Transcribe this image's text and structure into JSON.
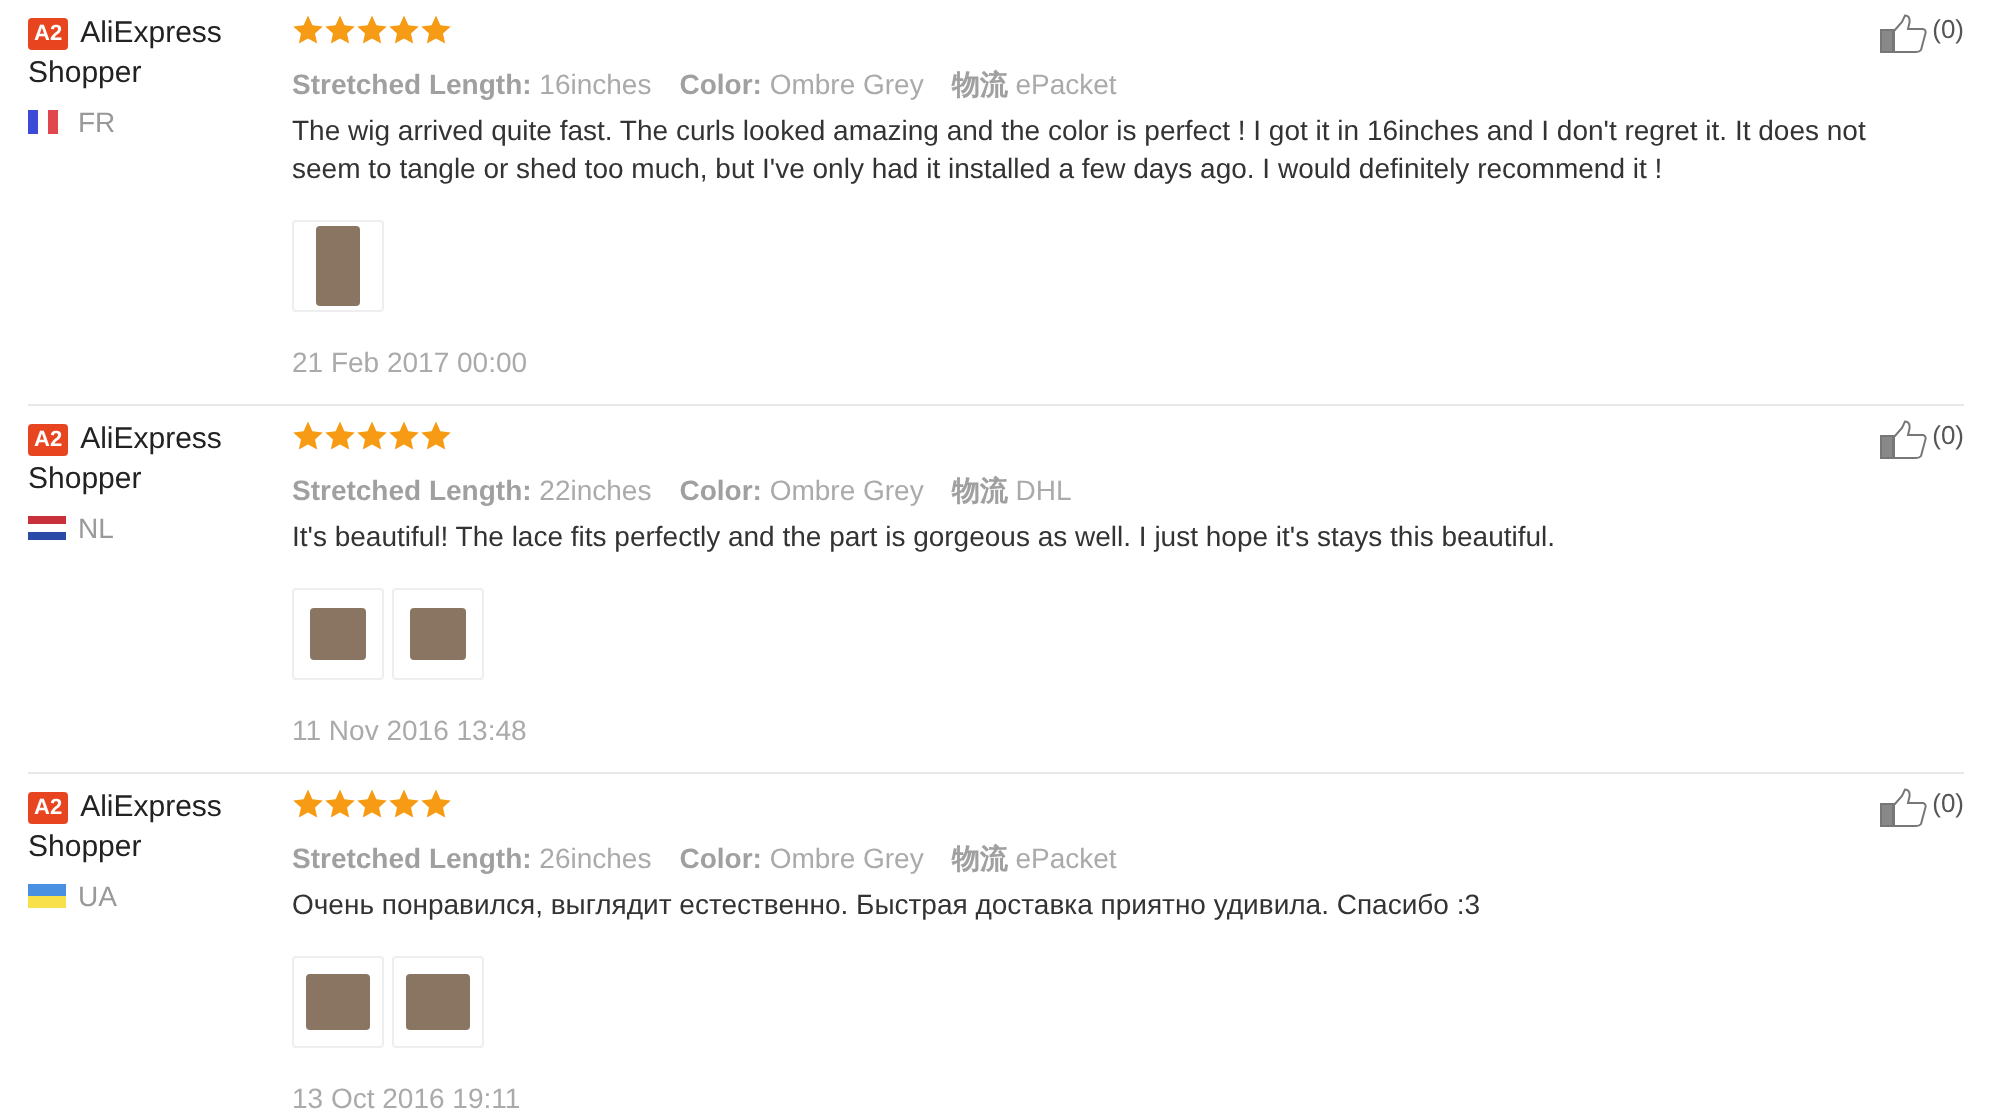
{
  "reviews": [
    {
      "badge": "A2",
      "name": "AliExpress Shopper",
      "flag": {
        "kind": "fr"
      },
      "country": "FR",
      "stars": 5,
      "attributes": [
        {
          "label": "Stretched Length:",
          "value": "16inches"
        },
        {
          "label": "Color:",
          "value": "Ombre Grey"
        },
        {
          "label": "物流",
          "value": "ePacket"
        }
      ],
      "text": "The wig arrived quite fast. The curls looked amazing and the color is perfect ! I got it in 16inches and I don't regret it. It does not seem to tangle or shed too much, but I've only had it installed a few days ago. I would definitely recommend it !",
      "photos": [
        {
          "kind": "narrow"
        }
      ],
      "date": "21 Feb 2017 00:00",
      "likes": "(0)"
    },
    {
      "badge": "A2",
      "name": "AliExpress Shopper",
      "flag": {
        "kind": "nl"
      },
      "country": "NL",
      "stars": 5,
      "attributes": [
        {
          "label": "Stretched Length:",
          "value": "22inches"
        },
        {
          "label": "Color:",
          "value": "Ombre Grey"
        },
        {
          "label": "物流",
          "value": "DHL"
        }
      ],
      "text": "It's beautiful! The lace fits perfectly and the part is gorgeous as well. I just hope it's stays this beautiful.",
      "photos": [
        {
          "kind": "small"
        },
        {
          "kind": "small"
        }
      ],
      "date": "11 Nov 2016 13:48",
      "likes": "(0)"
    },
    {
      "badge": "A2",
      "name": "AliExpress Shopper",
      "flag": {
        "kind": "ua"
      },
      "country": "UA",
      "stars": 5,
      "attributes": [
        {
          "label": "Stretched Length:",
          "value": "26inches"
        },
        {
          "label": "Color:",
          "value": "Ombre Grey"
        },
        {
          "label": "物流",
          "value": "ePacket"
        }
      ],
      "text": "Очень понравился, выглядит естественно. Быстрая доставка приятно удивила. Спасибо :3",
      "photos": [
        {
          "kind": "wide"
        },
        {
          "kind": "wide"
        }
      ],
      "date": "13 Oct 2016 19:11",
      "likes": "(0)"
    }
  ]
}
